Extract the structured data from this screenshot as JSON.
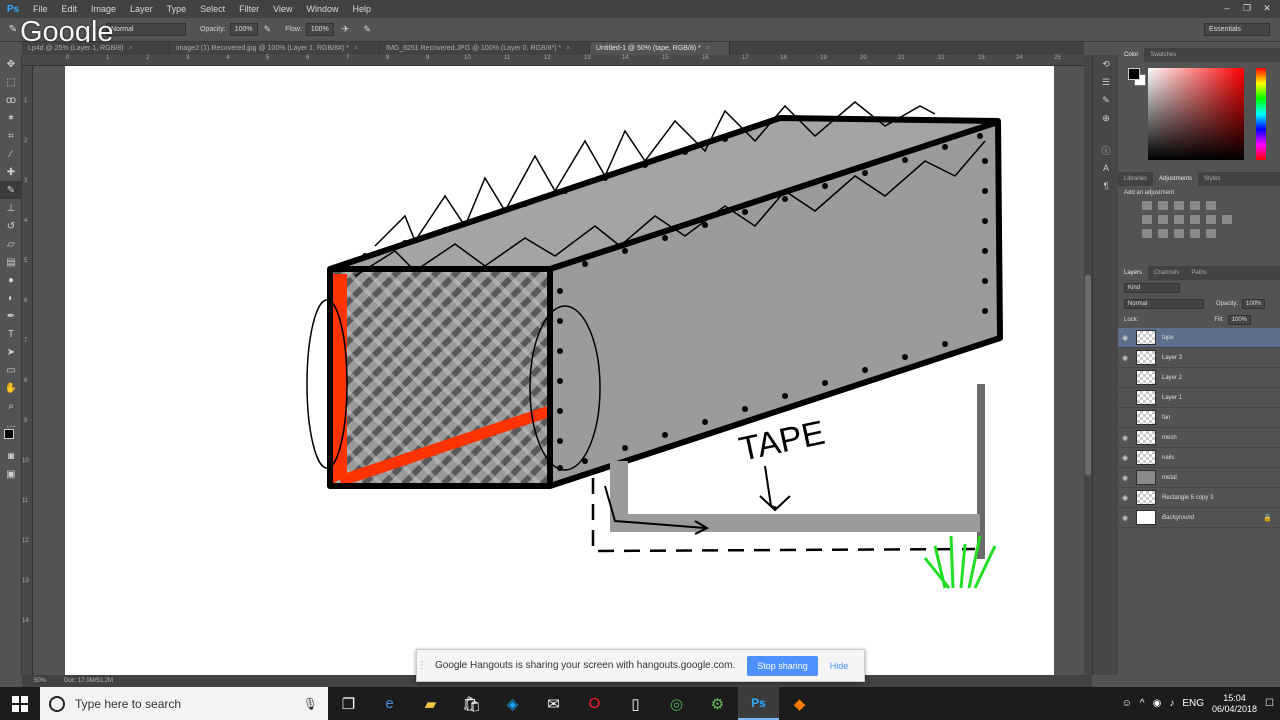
{
  "app": {
    "logo": "Ps",
    "watermark": "Google"
  },
  "menu": [
    "File",
    "Edit",
    "Image",
    "Layer",
    "Type",
    "Select",
    "Filter",
    "View",
    "Window",
    "Help"
  ],
  "window_controls": {
    "minimize": "–",
    "restore": "❐",
    "close": "✕"
  },
  "options": {
    "mode_value": "Normal",
    "opacity_label": "Opacity:",
    "opacity_value": "100%",
    "flow_label": "Flow:",
    "flow_value": "100%",
    "workspace": "Essentials"
  },
  "tabs": [
    {
      "label": "Lp4d @ 25% (Layer 1, RGB/8)",
      "close": "×"
    },
    {
      "label": "image2 (1) Recovered.jpg @ 100% (Layer 1, RGB/8#) *",
      "close": "×"
    },
    {
      "label": "IMG_6251 Recovered.JPG @ 100% (Layer 0, RGB/8*) *",
      "close": "×"
    },
    {
      "label": "Untitled-1 @ 50% (tape, RGB/8) *",
      "close": "×"
    }
  ],
  "ruler": {
    "top": [
      "0",
      "1",
      "2",
      "3",
      "4",
      "5",
      "6",
      "7",
      "8",
      "9",
      "10",
      "11",
      "12",
      "13",
      "14",
      "15",
      "16",
      "17",
      "18",
      "19",
      "20",
      "21",
      "22",
      "23",
      "24",
      "25"
    ],
    "left": [
      "1",
      "2",
      "3",
      "4",
      "5",
      "6",
      "7",
      "8",
      "9",
      "10",
      "11",
      "12",
      "13",
      "14"
    ]
  },
  "drawing": {
    "annotation": "TAPE"
  },
  "status": {
    "zoom": "50%",
    "doc": "Doc: 17.0M/51.2M"
  },
  "color_panel": {
    "tabs": [
      "Color",
      "Swatches"
    ]
  },
  "adjust_panel": {
    "tabs": [
      "Libraries",
      "Adjustments",
      "Styles"
    ],
    "heading": "Add an adjustment"
  },
  "layers_panel": {
    "tabs": [
      "Layers",
      "Channels",
      "Paths"
    ],
    "filter": "Kind",
    "blend": "Normal",
    "opacity_label": "Opacity:",
    "opacity_value": "100%",
    "lock_label": "Lock:",
    "fill_label": "Fill:",
    "fill_value": "100%",
    "layers": [
      {
        "name": "tape",
        "visible": true
      },
      {
        "name": "Layer 3",
        "visible": true
      },
      {
        "name": "Layer 2",
        "visible": false
      },
      {
        "name": "Layer 1",
        "visible": false
      },
      {
        "name": "fan",
        "visible": false
      },
      {
        "name": "mesh",
        "visible": true
      },
      {
        "name": "nails",
        "visible": true
      },
      {
        "name": "metal",
        "visible": true
      },
      {
        "name": "Rectangle 5 copy 3",
        "visible": true
      },
      {
        "name": "Background",
        "visible": true
      }
    ]
  },
  "share_bar": {
    "message": "Google Hangouts is sharing your screen with hangouts.google.com.",
    "stop": "Stop sharing",
    "hide": "Hide"
  },
  "taskbar": {
    "search_placeholder": "Type here to search",
    "language": "ENG",
    "time": "15:04",
    "date": "06/04/2018"
  }
}
